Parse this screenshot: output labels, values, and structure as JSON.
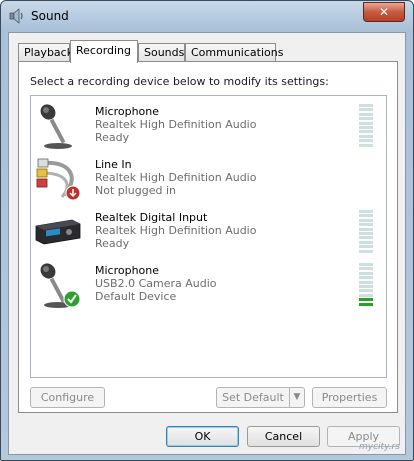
{
  "window": {
    "title": "Sound",
    "close_label": "✕"
  },
  "tabs": [
    {
      "label": "Playback"
    },
    {
      "label": "Recording"
    },
    {
      "label": "Sounds"
    },
    {
      "label": "Communications"
    }
  ],
  "instruction": "Select a recording device below to modify its settings:",
  "devices": [
    {
      "name": "Microphone",
      "driver": "Realtek High Definition Audio",
      "status": "Ready",
      "icon": "microphone-icon",
      "level_bars_lit": 0
    },
    {
      "name": "Line In",
      "driver": "Realtek High Definition Audio",
      "status": "Not plugged in",
      "icon": "line-in-cable-icon"
    },
    {
      "name": "Realtek Digital Input",
      "driver": "Realtek High Definition Audio",
      "status": "Ready",
      "icon": "digital-input-device-icon",
      "level_bars_lit": 0
    },
    {
      "name": "Microphone",
      "driver": "USB2.0 Camera Audio",
      "status": "Default Device",
      "icon": "microphone-default-icon",
      "level_bars_lit": 2
    }
  ],
  "buttons": {
    "configure": "Configure",
    "set_default": "Set Default",
    "properties": "Properties",
    "ok": "OK",
    "cancel": "Cancel",
    "apply": "Apply"
  },
  "watermark": "mycity.rs",
  "colors": {
    "meter_lit": "#2aa02a",
    "meter_unlit": "#cde0e0",
    "default_check": "#2ea02e",
    "unplugged_badge": "#c0302a"
  }
}
